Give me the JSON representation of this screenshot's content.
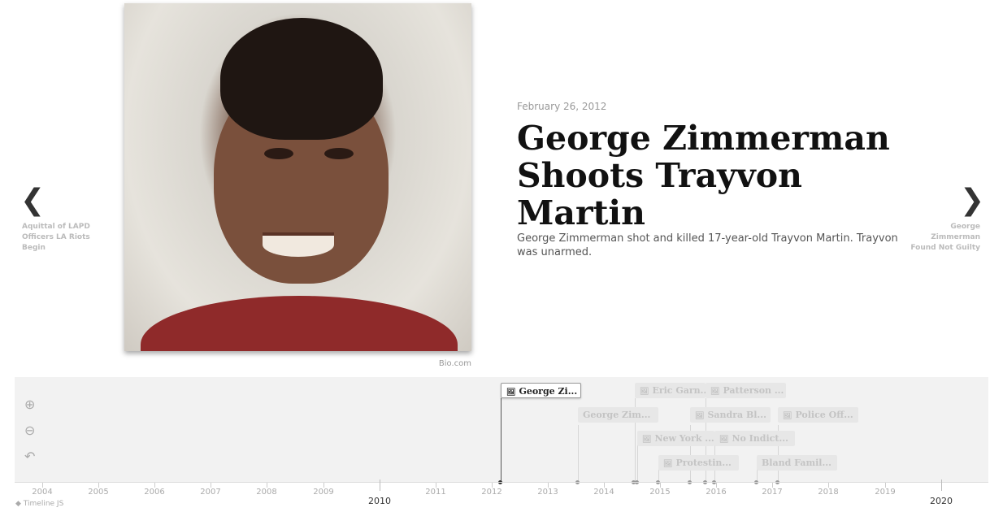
{
  "slide": {
    "date": "February 26, 2012",
    "headline": "George Zimmerman Shoots Trayvon Martin",
    "text": "George Zimmerman shot and killed 17-year-old Trayvon Martin. Trayvon was unarmed.",
    "media_credit": "Bio.com"
  },
  "nav": {
    "prev_title": "Aquittal of LAPD Officers LA Riots Begin",
    "next_title": "George Zimmerman Found Not Guilty",
    "prev_icon": "chevron-left-icon",
    "next_icon": "chevron-right-icon"
  },
  "timenav": {
    "zoom_in_icon": "zoom-in-icon",
    "zoom_out_icon": "zoom-out-icon",
    "back_icon": "back-icon",
    "markers": [
      {
        "label": "George Zi...",
        "icon": "image-icon",
        "active": true
      },
      {
        "label": "George Zim...",
        "icon": "",
        "active": false
      },
      {
        "label": "Eric Garn...",
        "icon": "image-icon",
        "active": false
      },
      {
        "label": "Patterson ...",
        "icon": "image-icon",
        "active": false
      },
      {
        "label": "Sandra Bl...",
        "icon": "image-icon",
        "active": false
      },
      {
        "label": "Police Off...",
        "icon": "image-icon",
        "active": false
      },
      {
        "label": "New York ...",
        "icon": "image-icon",
        "active": false
      },
      {
        "label": "No Indict...",
        "icon": "image-icon",
        "active": false
      },
      {
        "label": "Protestin...",
        "icon": "image-icon",
        "active": false
      },
      {
        "label": "Bland Famil...",
        "icon": "",
        "active": false
      }
    ],
    "ticks": [
      "2004",
      "2005",
      "2006",
      "2007",
      "2008",
      "2009",
      "2010",
      "2011",
      "2012",
      "2013",
      "2014",
      "2015",
      "2016",
      "2017",
      "2018",
      "2019",
      "2020"
    ],
    "major_ticks": [
      "2010",
      "2020"
    ],
    "brand": "Timeline JS"
  },
  "colors": {
    "accent": "#333333",
    "muted": "#aaaaaa",
    "panel": "#f2f2f2"
  }
}
